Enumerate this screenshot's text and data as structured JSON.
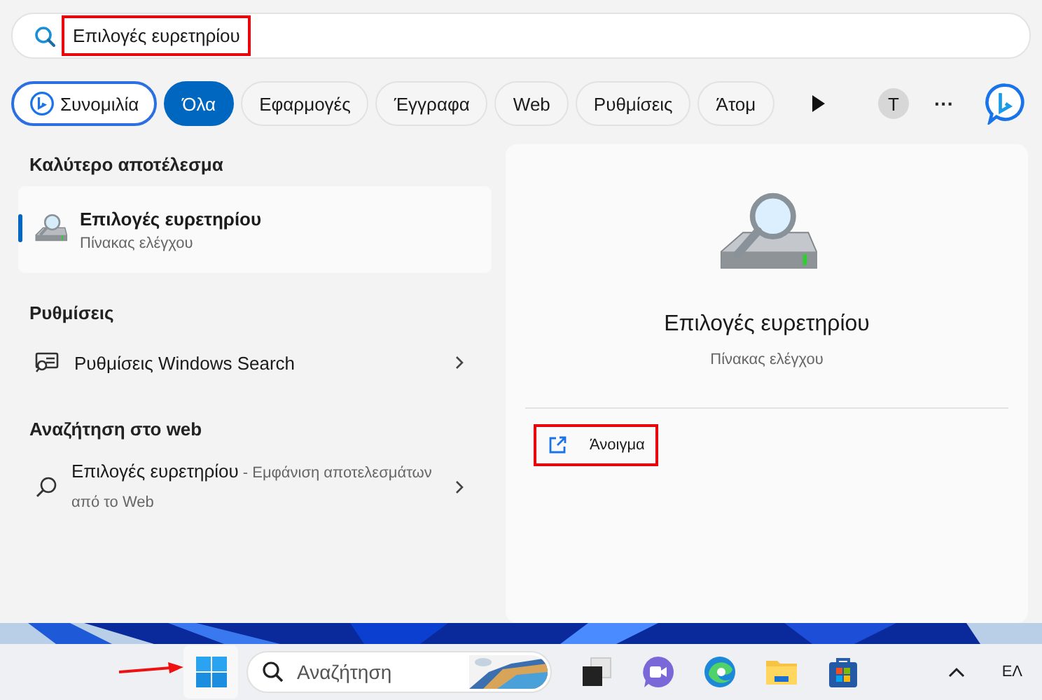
{
  "search": {
    "value": "Επιλογές ευρετηρίου",
    "highlighted": true
  },
  "filters": [
    {
      "label": "Συνομιλία",
      "kind": "chat",
      "selected": false
    },
    {
      "label": "Όλα",
      "kind": "chip",
      "selected": true
    },
    {
      "label": "Εφαρμογές",
      "kind": "chip",
      "selected": false
    },
    {
      "label": "Έγγραφα",
      "kind": "chip",
      "selected": false
    },
    {
      "label": "Web",
      "kind": "chip",
      "selected": false
    },
    {
      "label": "Ρυθμίσεις",
      "kind": "chip",
      "selected": false
    },
    {
      "label": "Άτομ",
      "kind": "chip",
      "selected": false
    }
  ],
  "account_initial": "T",
  "more": "···",
  "sections": [
    {
      "heading": "Καλύτερο αποτέλεσμα",
      "items": [
        {
          "kind": "best",
          "title": "Επιλογές ευρετηρίου",
          "subtitle": "Πίνακας ελέγχου",
          "selected": true
        }
      ]
    },
    {
      "heading": "Ρυθμίσεις",
      "items": [
        {
          "kind": "settings",
          "title": "Ρυθμίσεις Windows Search",
          "selected": false
        }
      ]
    },
    {
      "heading": "Αναζήτηση στο web",
      "items": [
        {
          "kind": "web",
          "title": "Επιλογές ευρετηρίου",
          "suffix": " - Εμφάνιση αποτελεσμάτων από το Web",
          "selected": false
        }
      ]
    }
  ],
  "preview": {
    "title": "Επιλογές ευρετηρίου",
    "subtitle": "Πίνακας ελέγχου",
    "actions": [
      {
        "label": "Άνοιγμα",
        "highlighted": true
      }
    ]
  },
  "taskbar": {
    "start_pointer": true,
    "search_placeholder": "Αναζήτηση",
    "language": "ΕΛ"
  }
}
